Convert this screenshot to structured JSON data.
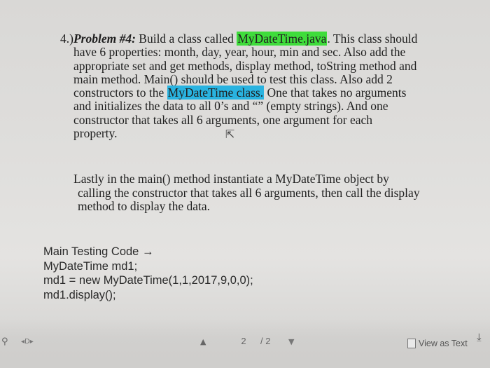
{
  "problem": {
    "number": "4.)",
    "heading": "Problem #4:",
    "line1_a": "Build a class called",
    "line1_hl": "MyDateTime.java",
    "line1_b": ". This class should",
    "line2": "have 6 properties:  month, day, year, hour, min and sec.  Also add the",
    "line3": "appropriate set and get methods, display method, toString method and",
    "line4": "main method.  Main() should be used to test this class.  Also add 2",
    "line5_a": "constructors to the",
    "line5_hl": "MyDateTime class.",
    "line5_b": "One that takes no arguments",
    "line6": "and initializes the data to all 0’s and  “”  (empty strings).  And one",
    "line7": "constructor that takes all 6 arguments,  one argument for each",
    "line8": "property."
  },
  "lastly": {
    "line1": "Lastly in the main() method instantiate a MyDateTime object by",
    "line2": "calling the constructor that takes all 6 arguments, then call the display",
    "line3": "method to display the data."
  },
  "code": {
    "line1": "Main Testing Code →",
    "line2": "MyDateTime md1;",
    "line3": "md1 = new MyDateTime(1,1,2017,9,0,0);",
    "line4": "md1.display();"
  },
  "toolbar": {
    "current_page": "2",
    "total_pages": "/ 2",
    "view_as_text": "View as Text",
    "icons": [
      "search-icon",
      "nav-icon",
      "prev-page-icon",
      "next-page-icon",
      "document-icon",
      "download-icon"
    ]
  },
  "colors": {
    "highlight_green": "#3fdc3b",
    "highlight_blue": "#29b3e0"
  }
}
